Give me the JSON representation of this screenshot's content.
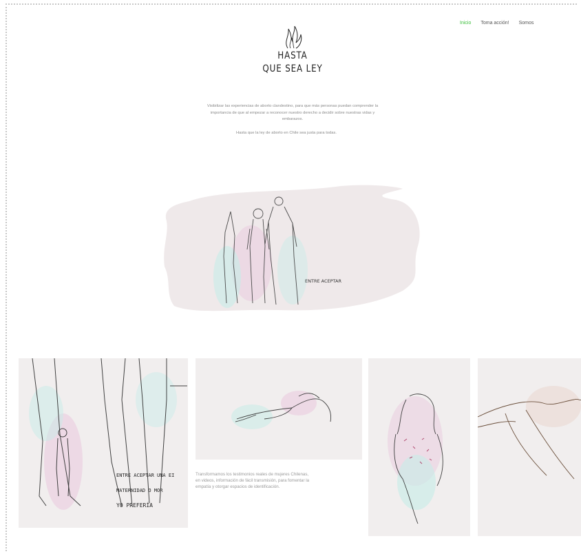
{
  "nav": {
    "items": [
      {
        "label": "Inicio",
        "active": true
      },
      {
        "label": "Toma acción!",
        "active": false
      },
      {
        "label": "Somos",
        "active": false
      }
    ],
    "active_color": "#3bbf3b"
  },
  "logo": {
    "line1": "HASTA",
    "line2": "QUE SEA LEY",
    "icon": "flame-icon"
  },
  "intro": {
    "paragraph1": "Visibilizar las experiencias de aborto clandestino, para que más personas puedan comprender la importancia de que al empezar a reconocer nuestro derecho a decidir sobre nuestras vidas y embarazos.",
    "paragraph2": "Hasta que la ley de aborto en Chile sea justa para todas."
  },
  "hero": {
    "handwritten_text": "ENTRE ACEPTAR"
  },
  "gallery": {
    "photo1_text_lines": [
      "ENTRE ACEPTAR UNA EI",
      "MATERNIDAD O MOR",
      "YO PREFERÍA"
    ],
    "caption": "Transformamos los testimonios reales de mujeres Chilenas, en videos, información de fácil transmisión, para fomentar la empatía y otorgar espacios de identificación."
  }
}
